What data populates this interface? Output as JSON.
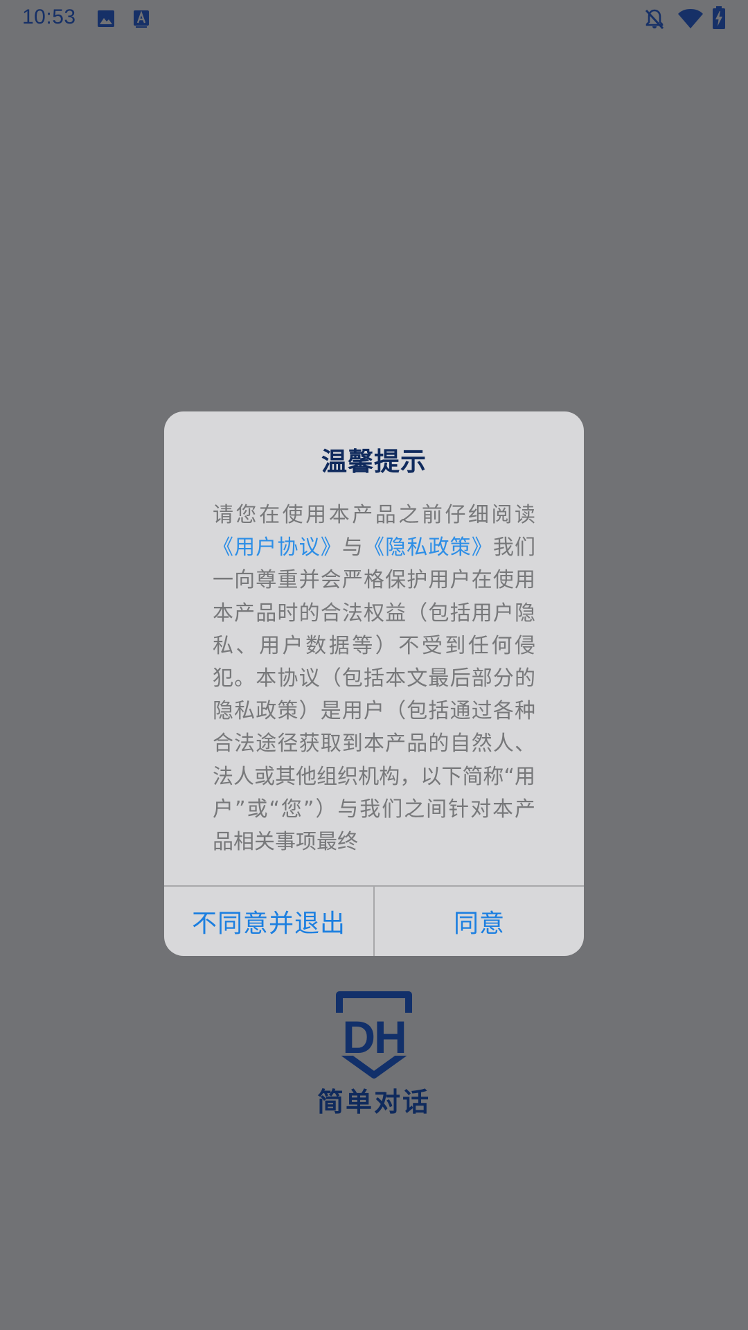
{
  "status_bar": {
    "time": "10:53",
    "left_icons": [
      "image-icon",
      "font-icon"
    ],
    "right_icons": [
      "notifications-off-icon",
      "wifi-icon",
      "battery-charging-icon"
    ]
  },
  "dialog": {
    "title": "温馨提示",
    "body_intro": "请您在使用本产品之前仔细阅读",
    "link_user_agreement": "《用户协议》",
    "connector": "与",
    "link_privacy_policy": "《隐私政策》",
    "body_rest": "我们一向尊重并会严格保护用户在使用本产品时的合法权益（包括用户隐私、用户数据等）不受到任何侵犯。本协议（包括本文最后部分的隐私政策）是用户（包括通过各种合法途径获取到本产品的自然人、法人或其他组织机构，以下简称“用户”或“您”）与我们之间针对本产品相关事项最终",
    "btn_disagree": "不同意并退出",
    "btn_agree": "同意"
  },
  "brand": {
    "logo_text": "DH",
    "name": "简单对话"
  },
  "colors": {
    "overlay": "#717275",
    "dialog_bg": "#d8d8da",
    "title": "#0f2a5d",
    "body_text": "#77787a",
    "link": "#2d8ee6",
    "button_text": "#1c7fe0"
  }
}
